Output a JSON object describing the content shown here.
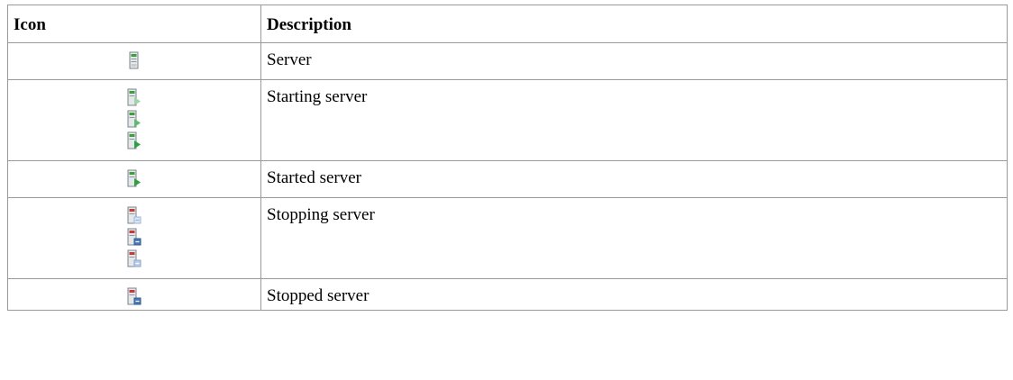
{
  "table": {
    "headers": {
      "icon": "Icon",
      "description": "Description"
    },
    "rows": [
      {
        "description": "Server",
        "icons": [
          "server-icon"
        ]
      },
      {
        "description": "Starting server",
        "icons": [
          "server-starting-icon-frame-1",
          "server-starting-icon-frame-2",
          "server-starting-icon-frame-3"
        ]
      },
      {
        "description": "Started server",
        "icons": [
          "server-started-icon"
        ]
      },
      {
        "description": "Stopping server",
        "icons": [
          "server-stopping-icon-frame-1",
          "server-stopping-icon-frame-2",
          "server-stopping-icon-frame-3"
        ]
      },
      {
        "description": "Stopped server",
        "icons": [
          "server-stopped-icon"
        ]
      }
    ]
  },
  "colors": {
    "border": "#9a9a9a",
    "server_body": "#e4e8ea",
    "server_led": "#3aa03a",
    "server_led_stop": "#c83a3a",
    "play_green": "#2fa03f",
    "play_light": "#9fd3a8",
    "stop_blue": "#4a7bb8",
    "stop_light": "#b9cde6"
  }
}
